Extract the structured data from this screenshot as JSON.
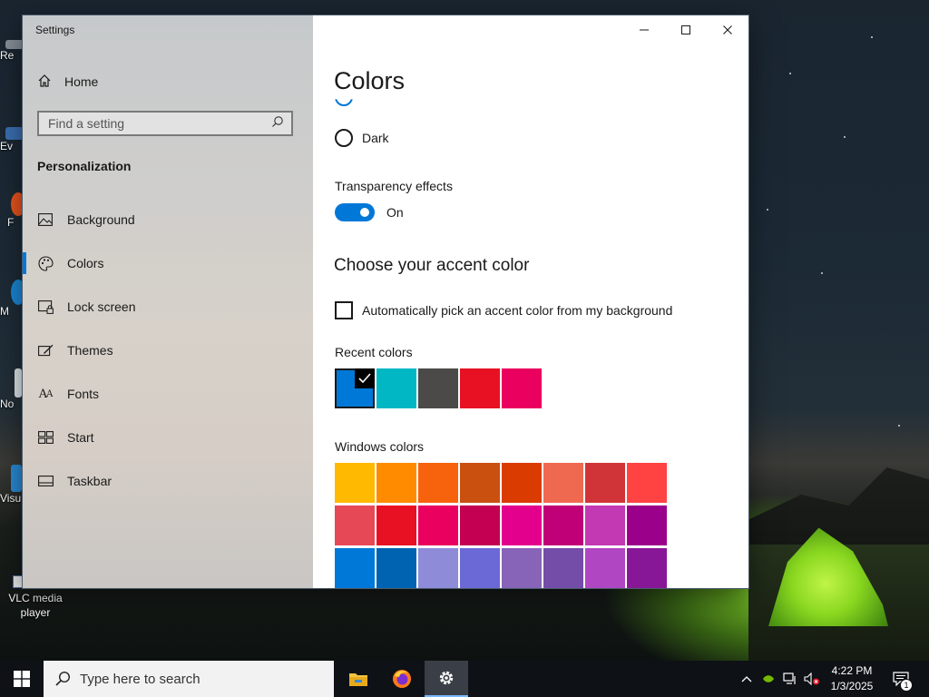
{
  "desktop": {
    "icon_fragments": [
      "Re",
      "Ev",
      "F",
      "M",
      "No",
      "Visu"
    ],
    "vlc_label": "VLC media player"
  },
  "window": {
    "title": "Settings",
    "controls": {
      "minimize": "minimize",
      "maximize": "maximize",
      "close": "close"
    }
  },
  "nav": {
    "home_label": "Home",
    "search_placeholder": "Find a setting",
    "section_title": "Personalization",
    "items": [
      {
        "label": "Background",
        "icon": "picture-icon"
      },
      {
        "label": "Colors",
        "icon": "palette-icon",
        "active": true
      },
      {
        "label": "Lock screen",
        "icon": "lock-screen-icon"
      },
      {
        "label": "Themes",
        "icon": "brush-icon"
      },
      {
        "label": "Fonts",
        "icon": "font-icon"
      },
      {
        "label": "Start",
        "icon": "start-icon"
      },
      {
        "label": "Taskbar",
        "icon": "taskbar-icon"
      }
    ]
  },
  "content": {
    "page_title": "Colors",
    "mode_option_dark": "Dark",
    "transparency_label": "Transparency effects",
    "transparency_state": "On",
    "accent_heading": "Choose your accent color",
    "auto_accent_label": "Automatically pick an accent color from my background",
    "recent_colors_label": "Recent colors",
    "recent_colors": [
      "#0078d7",
      "#00b7c3",
      "#4c4a48",
      "#e81123",
      "#ea005e"
    ],
    "selected_recent_color": "#0078d7",
    "windows_colors_label": "Windows colors",
    "windows_colors": [
      [
        "#ffb900",
        "#ff8c00",
        "#f7630c",
        "#ca5010",
        "#da3b01",
        "#ef6950",
        "#d13438",
        "#ff4343"
      ],
      [
        "#e74856",
        "#e81123",
        "#ea005e",
        "#c30052",
        "#e3008c",
        "#bf0077",
        "#c239b3",
        "#9a0089"
      ],
      [
        "#0078d7",
        "#0063b1",
        "#8e8cd8",
        "#6b69d6",
        "#8764b8",
        "#744da9",
        "#b146c2",
        "#881798"
      ]
    ]
  },
  "taskbar": {
    "search_placeholder": "Type here to search",
    "apps": [
      "file-explorer-icon",
      "firefox-icon",
      "settings-icon"
    ],
    "clock_time": "4:22 PM",
    "clock_date": "1/3/2025",
    "notification_count": "1"
  }
}
